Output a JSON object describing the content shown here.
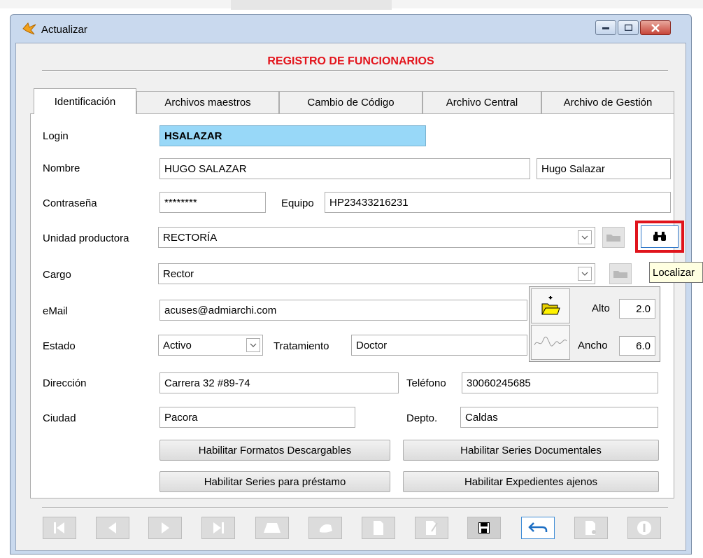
{
  "window": {
    "title": "Actualizar",
    "minimize_icon": "minimize-icon",
    "maximize_icon": "maximize-icon",
    "close_icon": "close-icon",
    "close_color": "#c7463a"
  },
  "form": {
    "heading": "REGISTRO DE FUNCIONARIOS",
    "heading_color": "#e3141c",
    "tabs": [
      {
        "label": "Identificación",
        "active": true
      },
      {
        "label": "Archivos maestros",
        "active": false
      },
      {
        "label": "Cambio de Código",
        "active": false
      },
      {
        "label": "Archivo Central",
        "active": false
      },
      {
        "label": "Archivo de Gestión",
        "active": false
      }
    ],
    "fields": {
      "login": {
        "label": "Login",
        "value": "HSALAZAR",
        "highlight": "#98d8f8"
      },
      "nombre": {
        "label": "Nombre",
        "value": "HUGO SALAZAR",
        "short_value": "Hugo Salazar"
      },
      "contrasena": {
        "label": "Contraseña",
        "value": "********"
      },
      "equipo": {
        "label": "Equipo",
        "value": "HP23433216231"
      },
      "unidad": {
        "label": "Unidad productora",
        "value": "RECTORÍA"
      },
      "cargo": {
        "label": "Cargo",
        "value": "Rector"
      },
      "email": {
        "label": "eMail",
        "value": "acuses@admiarchi.com"
      },
      "estado": {
        "label": "Estado",
        "value": "Activo"
      },
      "tratamiento": {
        "label": "Tratamiento",
        "value": "Doctor"
      },
      "direccion": {
        "label": "Dirección",
        "value": "Carrera 32 #89-74"
      },
      "telefono": {
        "label": "Teléfono",
        "value": "30060245685"
      },
      "ciudad": {
        "label": "Ciudad",
        "value": "Pacora"
      },
      "depto": {
        "label": "Depto.",
        "value": "Caldas"
      }
    },
    "signature": {
      "alto_label": "Alto",
      "alto_value": "2.0",
      "ancho_label": "Ancho",
      "ancho_value": "6.0"
    },
    "buttons": {
      "formatos": "Habilitar Formatos Descargables",
      "series": "Habilitar Series Documentales",
      "prestamo": "Habilitar Series para préstamo",
      "expedientes": "Habilitar Expedientes ajenos"
    },
    "tooltip": "Localizar",
    "highlight_color": "#e0141c"
  },
  "toolbar": {
    "buttons": [
      "first-record-icon",
      "previous-record-icon",
      "next-record-icon",
      "last-record-icon",
      "add-record-icon",
      "delete-record-icon",
      "new-document-icon",
      "edit-document-icon",
      "save-icon",
      "undo-icon",
      "print-icon",
      "info-icon"
    ]
  }
}
